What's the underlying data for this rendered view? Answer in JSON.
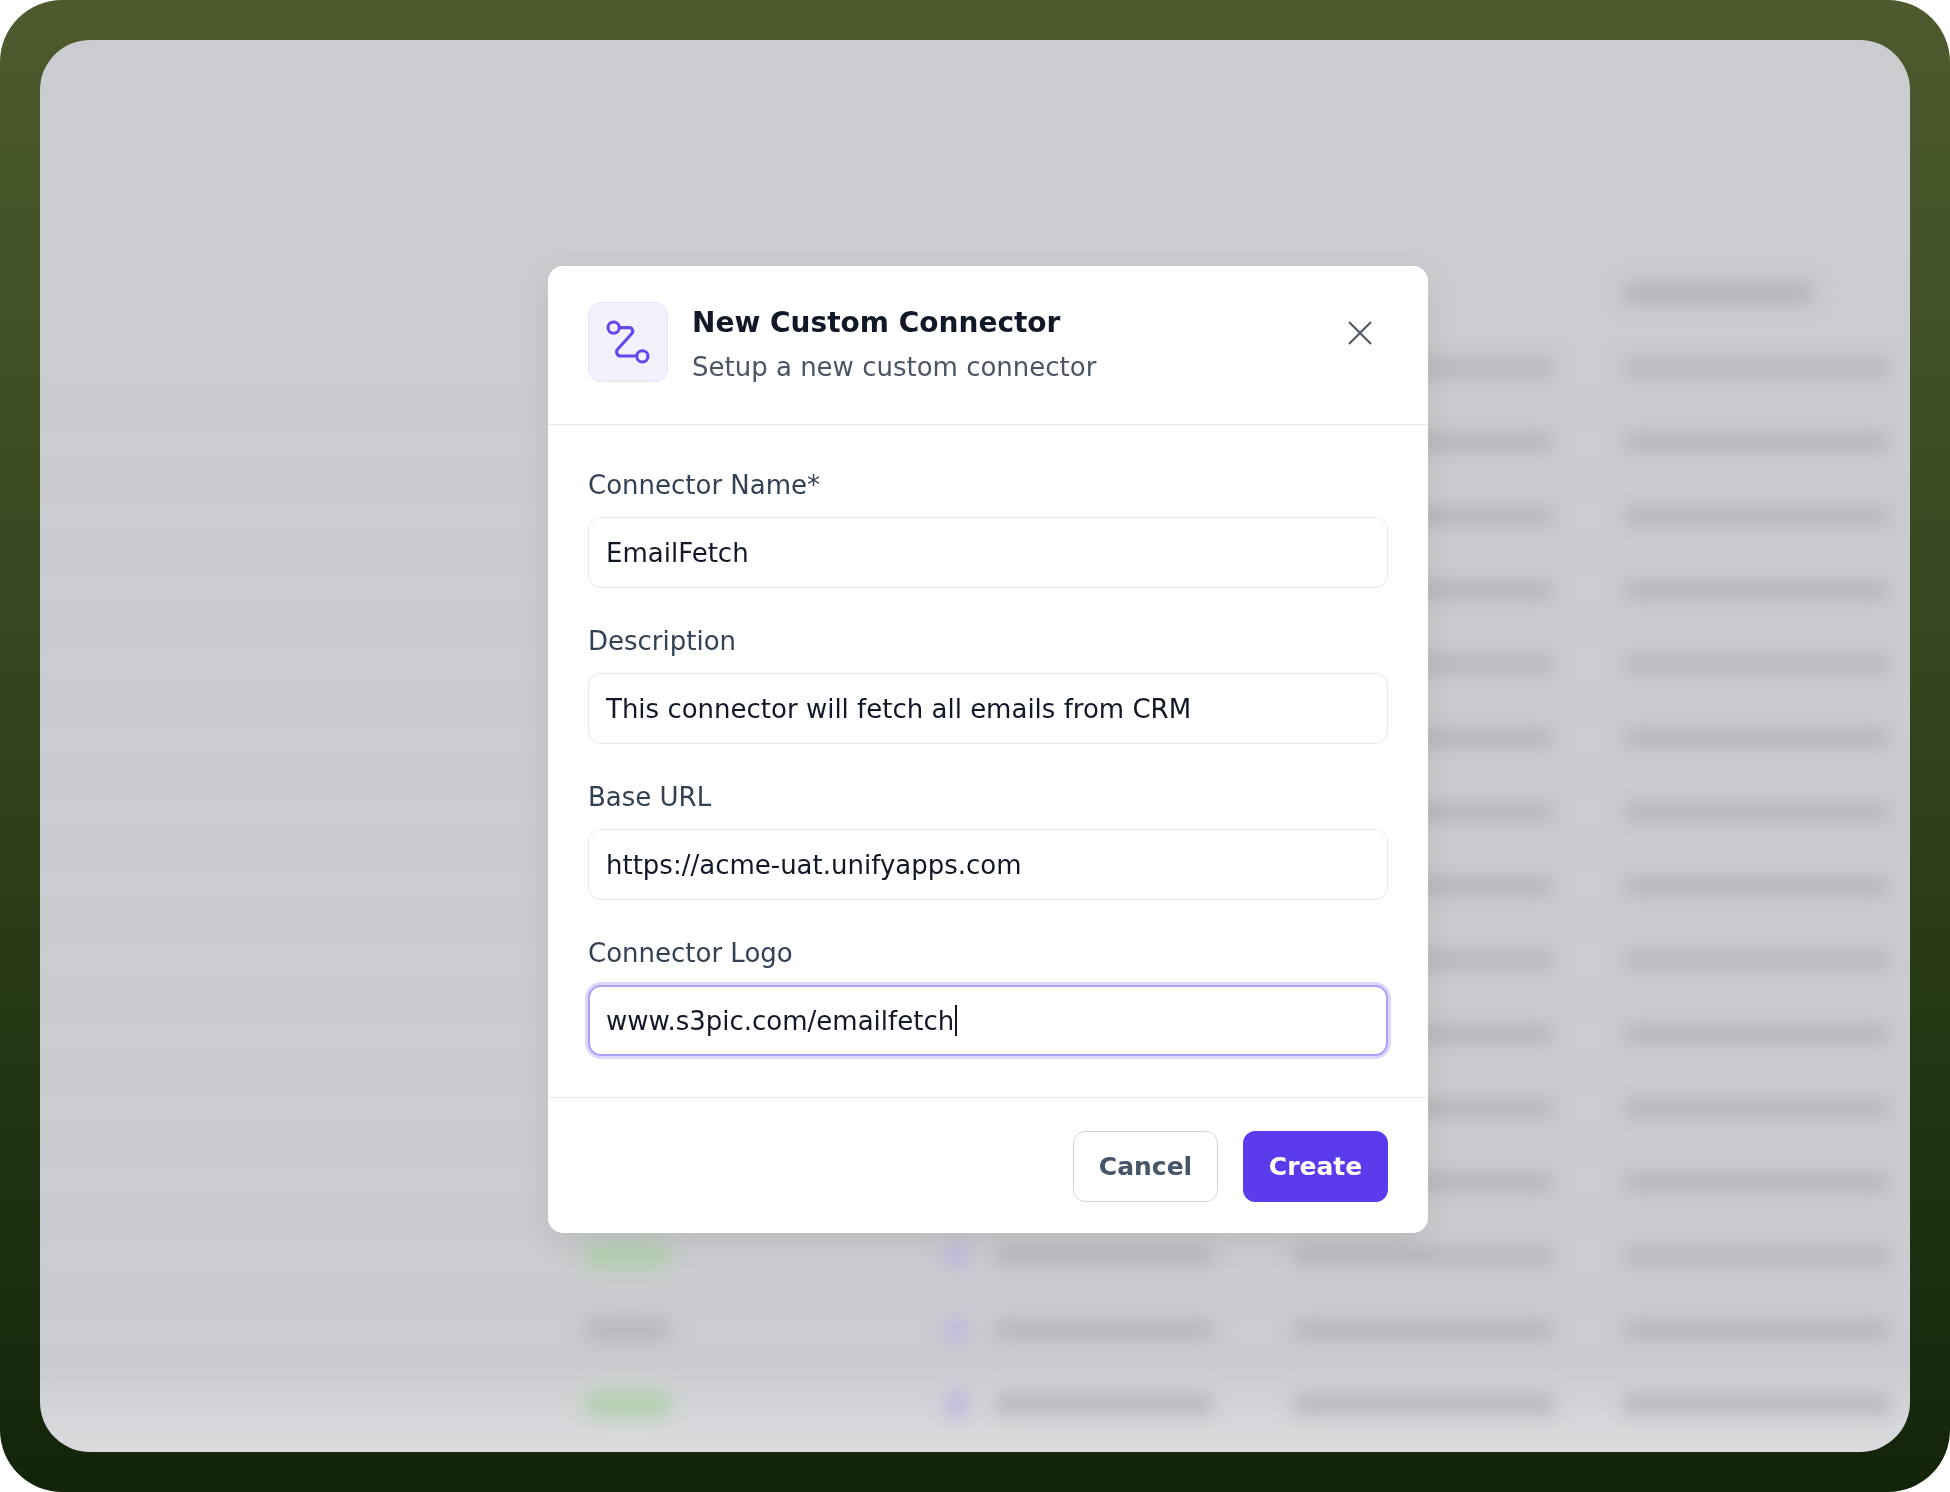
{
  "dialog": {
    "title": "New Custom Connector",
    "subtitle": "Setup a new custom connector",
    "fields": [
      {
        "label": "Connector Name*",
        "value": "EmailFetch",
        "focused": false
      },
      {
        "label": "Description",
        "value": "This connector will fetch all emails from CRM",
        "focused": false
      },
      {
        "label": "Base URL",
        "value": "https://acme-uat.unifyapps.com",
        "focused": false
      },
      {
        "label": "Connector Logo",
        "value": "www.s3pic.com/emailfetch",
        "focused": true
      }
    ],
    "buttons": [
      {
        "label": "Cancel",
        "kind": "secondary"
      },
      {
        "label": "Create",
        "kind": "primary"
      }
    ]
  }
}
